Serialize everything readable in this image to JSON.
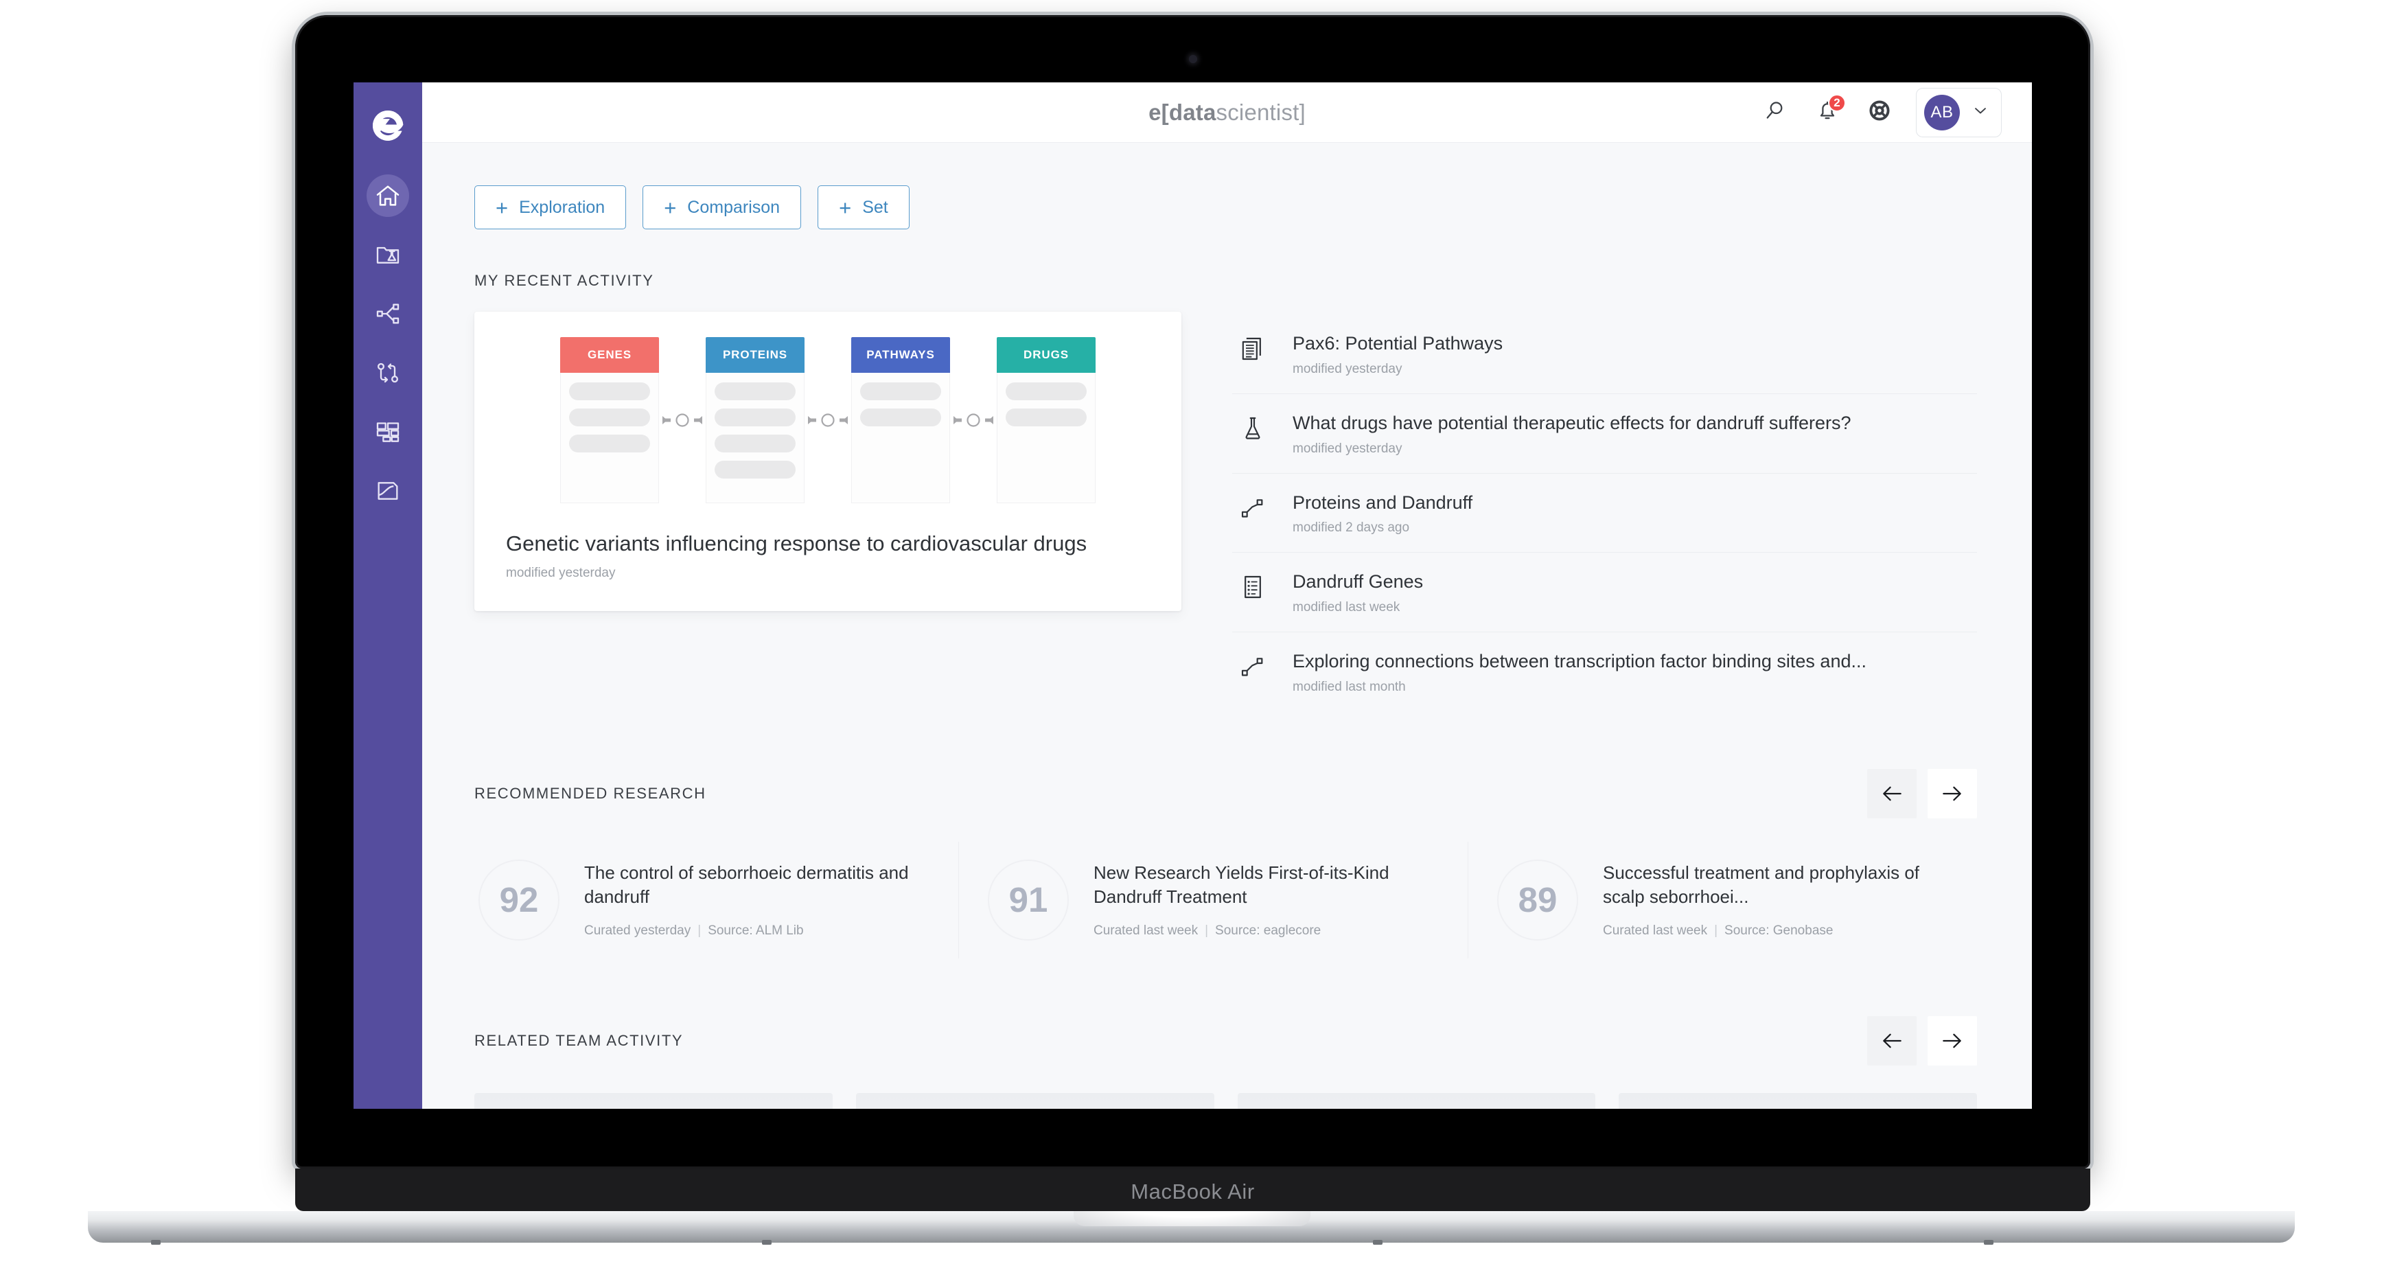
{
  "device": {
    "label": "MacBook Air"
  },
  "topbar": {
    "brand_bold": "e[data",
    "brand_light": "scientist]",
    "search_icon": "search-icon",
    "notifications_icon": "bell-icon",
    "notifications_count": "2",
    "help_icon": "lifebuoy-icon",
    "avatar_initials": "AB",
    "chevron_icon": "chevron-down-icon"
  },
  "sidebar": {
    "logo": "e-logo",
    "items": [
      {
        "name": "home",
        "icon": "home-icon",
        "active": true
      },
      {
        "name": "projects",
        "icon": "folder-flask-icon",
        "active": false
      },
      {
        "name": "network",
        "icon": "share-network-icon",
        "active": false
      },
      {
        "name": "workflows",
        "icon": "swap-nodes-icon",
        "active": false
      },
      {
        "name": "datasets",
        "icon": "grid-blocks-icon",
        "active": false
      },
      {
        "name": "archive",
        "icon": "folder-document-icon",
        "active": false
      }
    ]
  },
  "create_buttons": [
    {
      "label": "Exploration"
    },
    {
      "label": "Comparison"
    },
    {
      "label": "Set"
    }
  ],
  "recent": {
    "section_title": "MY RECENT ACTIVITY",
    "hero": {
      "title": "Genetic variants influencing response to cardiovascular drugs",
      "subtitle": "modified yesterday",
      "columns": [
        {
          "label": "GENES",
          "color": "#f2706b",
          "rows": 3
        },
        {
          "label": "PROTEINS",
          "color": "#3d94c8",
          "rows": 4
        },
        {
          "label": "PATHWAYS",
          "color": "#4a68c4",
          "rows": 2
        },
        {
          "label": "DRUGS",
          "color": "#26b0a6",
          "rows": 2
        }
      ]
    },
    "items": [
      {
        "icon": "documents-stack-icon",
        "title": "Pax6: Potential Pathways",
        "meta": "modified yesterday"
      },
      {
        "icon": "flask-icon",
        "title": "What drugs have potential therapeutic effects for dandruff sufferers?",
        "meta": "modified yesterday"
      },
      {
        "icon": "node-graph-icon",
        "title": "Proteins and Dandruff",
        "meta": "modified 2 days ago"
      },
      {
        "icon": "list-document-icon",
        "title": "Dandruff Genes",
        "meta": "modified last week"
      },
      {
        "icon": "node-graph-icon",
        "title": "Exploring connections between transcription factor binding sites and...",
        "meta": "modified last month"
      }
    ]
  },
  "recommended": {
    "section_title": "RECOMMENDED RESEARCH",
    "prev_icon": "arrow-left-icon",
    "next_icon": "arrow-right-icon",
    "cards": [
      {
        "score": "92",
        "title": "The control of seborrhoeic dermatitis and dandruff",
        "curated": "Curated yesterday",
        "source": "Source: ALM Lib"
      },
      {
        "score": "91",
        "title": "New Research Yields First-of-its-Kind Dandruff Treatment",
        "curated": "Curated last week",
        "source": "Source: eaglecore"
      },
      {
        "score": "89",
        "title": "Successful treatment and prophylaxis of scalp seborrhoei...",
        "curated": "Curated last week",
        "source": "Source: Genobase"
      }
    ]
  },
  "team": {
    "section_title": "RELATED TEAM ACTIVITY",
    "prev_icon": "arrow-left-icon",
    "next_icon": "arrow-right-icon",
    "placeholder_count": 4
  },
  "colors": {
    "sidebar": "#554d9e",
    "accent_blue": "#3d86be",
    "badge_red": "#ef4a4a",
    "page_bg": "#f7f8fa"
  }
}
